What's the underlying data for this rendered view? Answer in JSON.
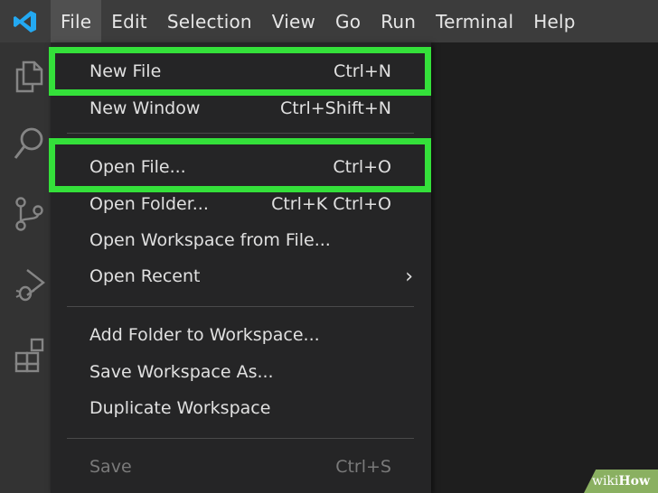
{
  "menubar": {
    "items": [
      {
        "label": "File",
        "active": true
      },
      {
        "label": "Edit"
      },
      {
        "label": "Selection"
      },
      {
        "label": "View"
      },
      {
        "label": "Go"
      },
      {
        "label": "Run"
      },
      {
        "label": "Terminal"
      },
      {
        "label": "Help"
      }
    ]
  },
  "activity_icons": [
    "explorer-icon",
    "search-icon",
    "source-control-icon",
    "run-debug-icon",
    "extensions-icon"
  ],
  "file_menu": {
    "new_file": {
      "label": "New File",
      "shortcut": "Ctrl+N"
    },
    "new_window": {
      "label": "New Window",
      "shortcut": "Ctrl+Shift+N"
    },
    "open_file": {
      "label": "Open File...",
      "shortcut": "Ctrl+O"
    },
    "open_folder": {
      "label": "Open Folder...",
      "shortcut": "Ctrl+K Ctrl+O"
    },
    "open_workspace": {
      "label": "Open Workspace from File..."
    },
    "open_recent": {
      "label": "Open Recent",
      "submenu_glyph": "›"
    },
    "add_folder": {
      "label": "Add Folder to Workspace..."
    },
    "save_workspace_as": {
      "label": "Save Workspace As..."
    },
    "duplicate_workspace": {
      "label": "Duplicate Workspace"
    },
    "save": {
      "label": "Save",
      "shortcut": "Ctrl+S",
      "disabled": true
    }
  },
  "colors": {
    "highlight": "#34e03a",
    "menubar_bg": "#3c3c3c",
    "menu_bg": "#252526",
    "vscode_blue": "#23a9f2"
  },
  "watermark": {
    "prefix": "wiki",
    "suffix": "How"
  }
}
